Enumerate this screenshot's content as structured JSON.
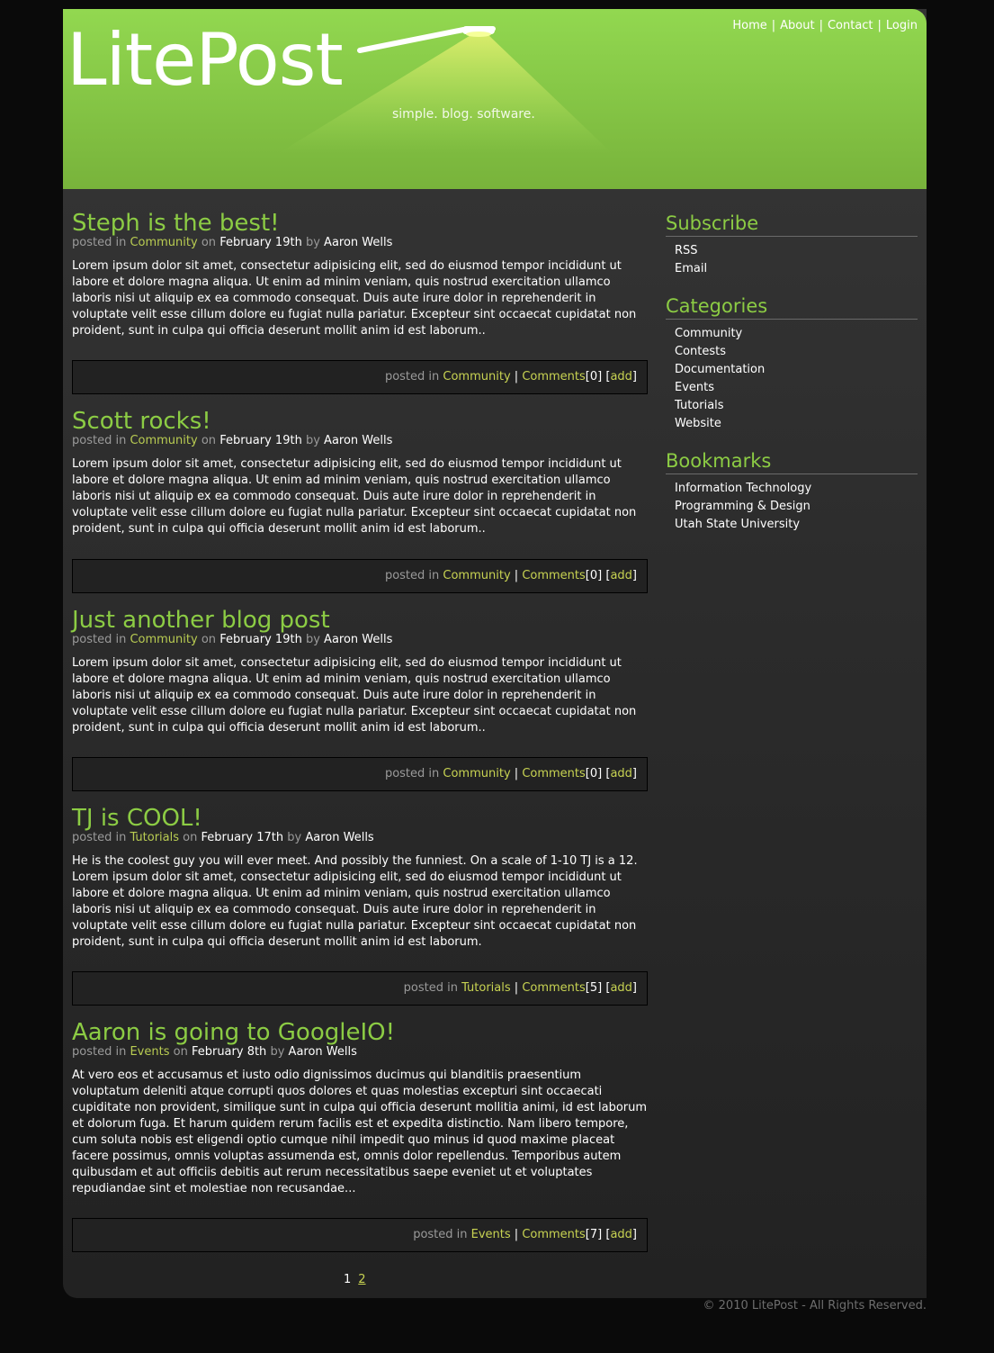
{
  "header": {
    "logo": "LitePost",
    "tagline": "simple. blog. software.",
    "nav": [
      "Home",
      "About",
      "Contact",
      "Login"
    ]
  },
  "posts": [
    {
      "title": "Steph is the best!",
      "meta_prefix": "posted in",
      "category": "Community",
      "on": "on",
      "date": "February 19th",
      "by": "by",
      "author": "Aaron Wells",
      "body": "Lorem ipsum dolor sit amet, consectetur adipisicing elit, sed do eiusmod tempor incididunt ut labore et dolore magna aliqua. Ut enim ad minim veniam, quis nostrud exercitation ullamco laboris nisi ut aliquip ex ea commodo consequat. Duis aute irure dolor in reprehenderit in voluptate velit esse cillum dolore eu fugiat nulla pariatur. Excepteur sint occaecat cupidatat non proident, sunt in culpa qui officia deserunt mollit anim id est laborum..",
      "footer": {
        "prefix": "posted in",
        "category": "Community",
        "comments": "Comments",
        "count": "[0]",
        "add": "add"
      }
    },
    {
      "title": "Scott rocks!",
      "meta_prefix": "posted in",
      "category": "Community",
      "on": "on",
      "date": "February 19th",
      "by": "by",
      "author": "Aaron Wells",
      "body": "Lorem ipsum dolor sit amet, consectetur adipisicing elit, sed do eiusmod tempor incididunt ut labore et dolore magna aliqua. Ut enim ad minim veniam, quis nostrud exercitation ullamco laboris nisi ut aliquip ex ea commodo consequat. Duis aute irure dolor in reprehenderit in voluptate velit esse cillum dolore eu fugiat nulla pariatur. Excepteur sint occaecat cupidatat non proident, sunt in culpa qui officia deserunt mollit anim id est laborum..",
      "footer": {
        "prefix": "posted in",
        "category": "Community",
        "comments": "Comments",
        "count": "[0]",
        "add": "add"
      }
    },
    {
      "title": "Just another blog post",
      "meta_prefix": "posted in",
      "category": "Community",
      "on": "on",
      "date": "February 19th",
      "by": "by",
      "author": "Aaron Wells",
      "body": "Lorem ipsum dolor sit amet, consectetur adipisicing elit, sed do eiusmod tempor incididunt ut labore et dolore magna aliqua. Ut enim ad minim veniam, quis nostrud exercitation ullamco laboris nisi ut aliquip ex ea commodo consequat. Duis aute irure dolor in reprehenderit in voluptate velit esse cillum dolore eu fugiat nulla pariatur. Excepteur sint occaecat cupidatat non proident, sunt in culpa qui officia deserunt mollit anim id est laborum..",
      "footer": {
        "prefix": "posted in",
        "category": "Community",
        "comments": "Comments",
        "count": "[0]",
        "add": "add"
      }
    },
    {
      "title": "TJ is COOL!",
      "meta_prefix": "posted in",
      "category": "Tutorials",
      "on": "on",
      "date": "February 17th",
      "by": "by",
      "author": "Aaron Wells",
      "body": "He is the coolest guy you will ever meet. And possibly the funniest. On a scale of 1-10 TJ is a 12. Lorem ipsum dolor sit amet, consectetur adipisicing elit, sed do eiusmod tempor incididunt ut labore et dolore magna aliqua. Ut enim ad minim veniam, quis nostrud exercitation ullamco laboris nisi ut aliquip ex ea commodo consequat. Duis aute irure dolor in reprehenderit in voluptate velit esse cillum dolore eu fugiat nulla pariatur. Excepteur sint occaecat cupidatat non proident, sunt in culpa qui officia deserunt mollit anim id est laborum.",
      "footer": {
        "prefix": "posted in",
        "category": "Tutorials",
        "comments": "Comments",
        "count": "[5]",
        "add": "add"
      }
    },
    {
      "title": "Aaron is going to GoogleIO!",
      "meta_prefix": "posted in",
      "category": "Events",
      "on": "on",
      "date": "February 8th",
      "by": "by",
      "author": "Aaron Wells",
      "body": "At vero eos et accusamus et iusto odio dignissimos ducimus qui blanditiis praesentium voluptatum deleniti atque corrupti quos dolores et quas molestias excepturi sint occaecati cupiditate non provident, similique sunt in culpa qui officia deserunt mollitia animi, id est laborum et dolorum fuga. Et harum quidem rerum facilis est et expedita distinctio. Nam libero tempore, cum soluta nobis est eligendi optio cumque nihil impedit quo minus id quod maxime placeat facere possimus, omnis voluptas assumenda est, omnis dolor repellendus. Temporibus autem quibusdam et aut officiis debitis aut rerum necessitatibus saepe eveniet ut et voluptates repudiandae sint et molestiae non recusandae...",
      "footer": {
        "prefix": "posted in",
        "category": "Events",
        "comments": "Comments",
        "count": "[7]",
        "add": "add"
      }
    }
  ],
  "pager": {
    "current": "1",
    "next": "2"
  },
  "sidebar": {
    "subscribe": {
      "title": "Subscribe",
      "items": [
        "RSS",
        "Email"
      ]
    },
    "categories": {
      "title": "Categories",
      "items": [
        "Community",
        "Contests",
        "Documentation",
        "Events",
        "Tutorials",
        "Website"
      ]
    },
    "bookmarks": {
      "title": "Bookmarks",
      "items": [
        "Information Technology",
        "Programming & Design",
        "Utah State University"
      ]
    }
  },
  "copyright": "© 2010 LitePost - All Rights Reserved.",
  "colors": {
    "accent_green": "#8ccc44",
    "link_yellow": "#c8d352",
    "background": "#0a0a0a"
  }
}
